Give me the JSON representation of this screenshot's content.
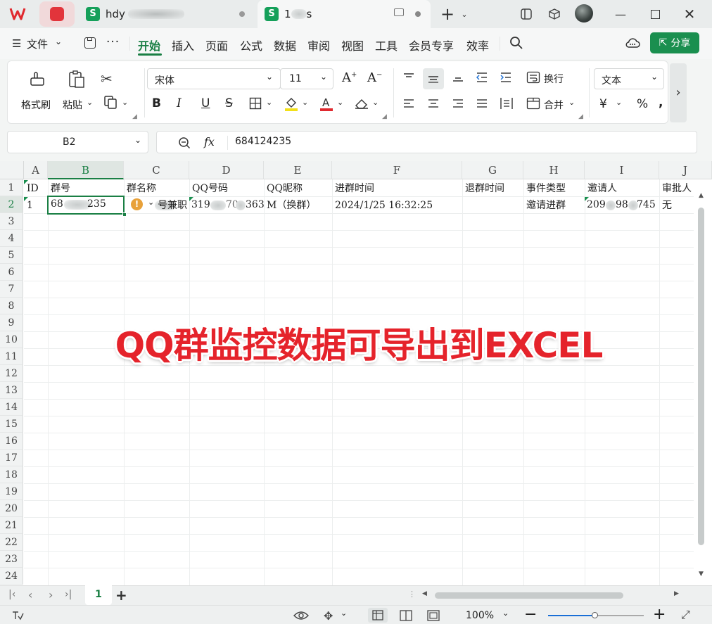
{
  "titlebar": {
    "tabs": [
      {
        "label": "hdy",
        "letter": "S"
      },
      {
        "label": "1",
        "suffix": "s",
        "letter": "S"
      }
    ]
  },
  "menu": {
    "file": "文件",
    "items": [
      "开始",
      "插入",
      "页面",
      "公式",
      "数据",
      "审阅",
      "视图",
      "工具",
      "会员专享",
      "效率"
    ],
    "share": "分享"
  },
  "ribbon": {
    "format_painter": "格式刷",
    "paste": "粘贴",
    "font_name": "宋体",
    "font_size": "11",
    "wrap": "换行",
    "merge": "合并",
    "number_format": "文本",
    "bold": "B",
    "italic": "I",
    "underline": "U",
    "strike": "S",
    "currency": "¥",
    "percent": "%"
  },
  "formula_bar": {
    "name_box": "B2",
    "fx": "fx",
    "value": "684124235"
  },
  "sheet": {
    "columns": [
      "A",
      "B",
      "C",
      "D",
      "E",
      "F",
      "G",
      "H",
      "I",
      "J"
    ],
    "rows": [
      "1",
      "2",
      "3",
      "4",
      "5",
      "6",
      "7",
      "8",
      "9",
      "10",
      "11",
      "12",
      "13",
      "14",
      "15",
      "16",
      "17",
      "18",
      "19",
      "20",
      "21",
      "22",
      "23",
      "24"
    ],
    "header_row": [
      "ID",
      "群号",
      "群名称",
      "QQ号码",
      "QQ昵称",
      "进群时间",
      "退群时间",
      "事件类型",
      "邀请人",
      "审批人"
    ],
    "data_row": {
      "id": "1",
      "group_no_a": "68",
      "group_no_b": "235",
      "group_name_visible": "号兼职",
      "qq_a": "319",
      "qq_b": "70",
      "qq_c": "363",
      "nickname": "M（换群）",
      "join_time": "2024/1/25 16:32:25",
      "event": "邀请进群",
      "inviter_a": "209",
      "inviter_b": "98",
      "inviter_c": "745",
      "approver": "无"
    },
    "overlay_text": "QQ群监控数据可导出到EXCEL"
  },
  "sheet_tabs": {
    "active": "1",
    "add": "+"
  },
  "status": {
    "zoom": "100%"
  }
}
